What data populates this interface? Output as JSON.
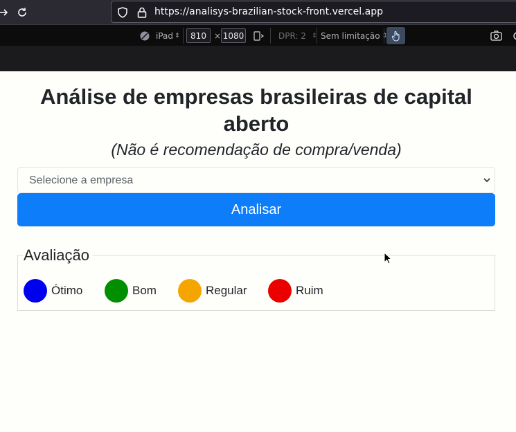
{
  "browser": {
    "url": "https://analisys-brazilian-stock-front.vercel.app"
  },
  "responsive_toolbar": {
    "device": "iPad",
    "width": "810",
    "times": "×",
    "height": "1080",
    "dpr": "DPR: 2",
    "throttling": "Sem limitação"
  },
  "page": {
    "title": "Análise de empresas brasileiras de capital aberto",
    "subtitle": "(Não é recomendação de compra/venda)",
    "select_placeholder": "Selecione a empresa",
    "analyze_button": "Analisar"
  },
  "evaluation": {
    "legend": "Avaliação",
    "items": [
      {
        "label": "Ótimo",
        "color": "#0000f0"
      },
      {
        "label": "Bom",
        "color": "#008f00"
      },
      {
        "label": "Regular",
        "color": "#f5a500"
      },
      {
        "label": "Ruim",
        "color": "#eb0000"
      }
    ]
  }
}
